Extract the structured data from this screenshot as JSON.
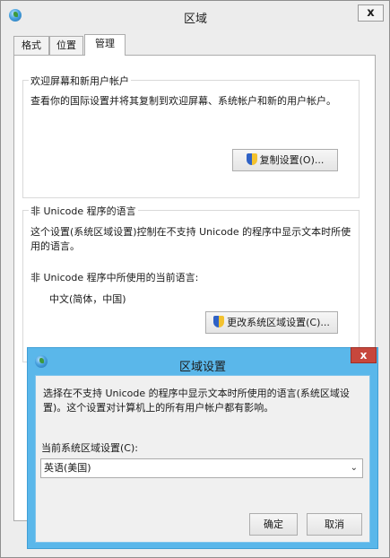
{
  "window": {
    "title": "区域",
    "close_label": "x",
    "tabs": [
      {
        "label": "格式"
      },
      {
        "label": "位置"
      },
      {
        "label": "管理"
      }
    ]
  },
  "welcome_group": {
    "title": "欢迎屏幕和新用户帐户",
    "description": "查看你的国际设置并将其复制到欢迎屏幕、系统帐户和新的用户帐户。",
    "copy_button": "复制设置(O)..."
  },
  "unicode_group": {
    "title": "非 Unicode 程序的语言",
    "description": "这个设置(系统区域设置)控制在不支持 Unicode 的程序中显示文本时所使用的语言。",
    "current_label": "非 Unicode 程序中所使用的当前语言:",
    "current_value": "中文(简体，中国)",
    "change_button": "更改系统区域设置(C)..."
  },
  "dialog": {
    "title": "区域设置",
    "close_label": "x",
    "description": "选择在不支持 Unicode 的程序中显示文本时所使用的语言(系统区域设置)。这个设置对计算机上的所有用户帐户都有影响。",
    "locale_label": "当前系统区域设置(C):",
    "locale_value": "英语(美国)",
    "ok_button": "确定",
    "cancel_button": "取消"
  }
}
